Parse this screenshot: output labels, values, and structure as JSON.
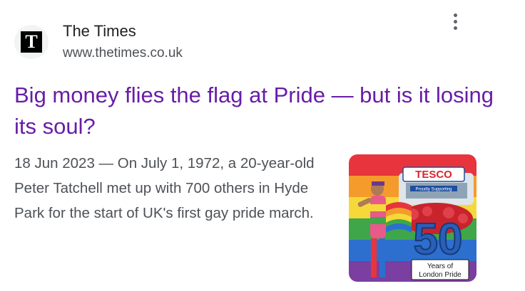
{
  "source": {
    "favicon_letter": "T",
    "name": "The Times",
    "url": "www.thetimes.co.uk"
  },
  "headline": "Big money flies the flag at Pride — but is it losing its soul?",
  "snippet": {
    "date": "18 Jun 2023",
    "separator": " — ",
    "text": "On July 1, 1972, a 20-year-old Peter Tatchell met up with 700 others in Hyde Park for the start of UK's first gay pride march."
  },
  "thumbnail": {
    "banner_text": "TESCO",
    "small_banner": "Proudly Supporting",
    "big_number": "50",
    "caption_line1": "Years of",
    "caption_line2": "London Pride"
  },
  "colors": {
    "headline": "#681da8",
    "site_name": "#202124",
    "body_text": "#4d5156",
    "menu_dots": "#5f6368",
    "favicon_bg": "#f1f3f4"
  },
  "icons": {
    "favicon": "the-times-logo-icon",
    "menu": "more-vert-icon"
  }
}
